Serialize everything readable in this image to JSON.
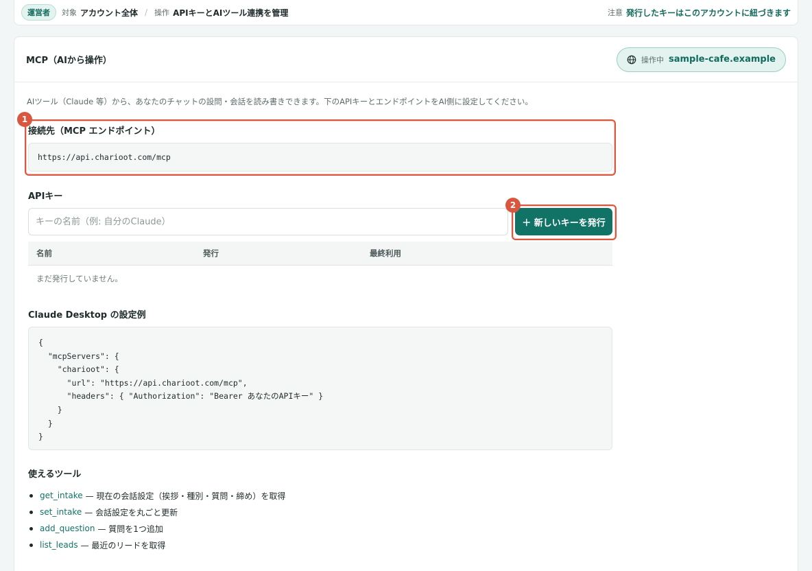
{
  "topbar": {
    "role_badge": "運営者",
    "target_label": "対象",
    "target_value": "アカウント全体",
    "operation_label": "操作",
    "operation_value": "APIキーとAIツール連携を管理",
    "note_label": "注意",
    "note_value": "発行したキーはこのアカウントに紐づきます"
  },
  "card": {
    "title": "MCP（AIから操作）",
    "active_label": "操作中",
    "active_value": "sample-cafe.example"
  },
  "intro": "AIツール（Claude 等）から、あなたのチャットの設問・会話を読み書きできます。下のAPIキーとエンドポイントをAI側に設定してください。",
  "endpoint": {
    "marker": "1",
    "label": "接続先（MCP エンドポイント）",
    "url": "https://api.charioot.com/mcp"
  },
  "api_key": {
    "label": "APIキー",
    "input_value": "",
    "input_placeholder": "キーの名前（例: 自分のClaude）",
    "marker": "2",
    "issue_button": "＋ 新しいキーを発行",
    "columns": [
      "名前",
      "発行",
      "最終利用"
    ],
    "empty_text": "まだ発行していません。"
  },
  "config_example": {
    "title": "Claude Desktop の設定例",
    "code": "{\n  \"mcpServers\": {\n    \"charioot\": {\n      \"url\": \"https://api.charioot.com/mcp\",\n      \"headers\": { \"Authorization\": \"Bearer あなたのAPIキー\" }\n    }\n  }\n}"
  },
  "tools": {
    "title": "使えるツール",
    "items": [
      {
        "name": "get_intake",
        "desc": "— 現在の会話設定（挨拶・種別・質問・締め）を取得"
      },
      {
        "name": "set_intake",
        "desc": "— 会話設定を丸ごと更新"
      },
      {
        "name": "add_question",
        "desc": "— 質問を1つ追加"
      },
      {
        "name": "list_leads",
        "desc": "— 最近のリードを取得"
      }
    ]
  },
  "colors": {
    "accent": "#117366",
    "highlight": "#d9573f"
  }
}
